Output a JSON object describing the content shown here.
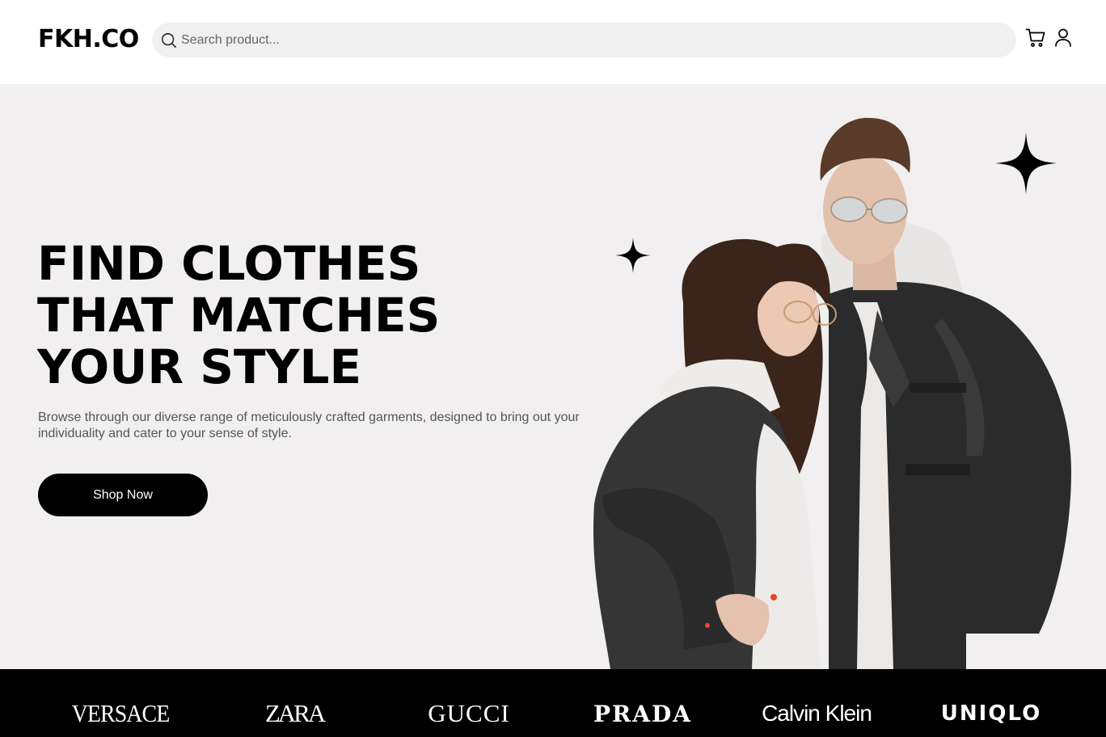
{
  "header": {
    "logo": "FKH.CO",
    "search": {
      "placeholder": "Search product...",
      "value": "",
      "icon": "search-icon"
    },
    "icons": [
      "cart-icon",
      "user-icon"
    ]
  },
  "hero": {
    "title_lines": [
      "FIND CLOTHES",
      "THAT MATCHES",
      "YOUR STYLE"
    ],
    "subtitle": "Browse through our diverse range of meticulously crafted garments, designed to bring out your individuality and cater to your sense of style.",
    "cta_label": "Shop Now",
    "decorations": [
      "sparkle-icon",
      "sparkle-icon"
    ]
  },
  "brands": [
    "VERSACE",
    "ZARA",
    "GUCCI",
    "PRADA",
    "Calvin Klein",
    "UNIQLO"
  ],
  "colors": {
    "hero_background": "#f1efef",
    "search_background": "#f0f0f0",
    "brand_bar": "#000000",
    "button": "#000000",
    "button_text": "#ffffff",
    "subtitle_text": "#555555"
  }
}
